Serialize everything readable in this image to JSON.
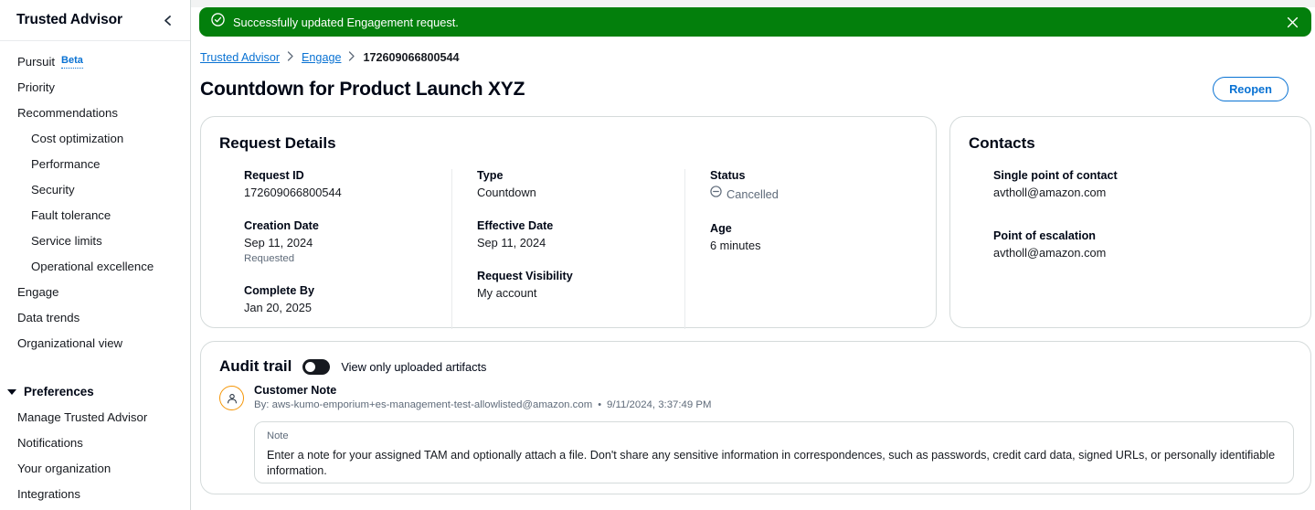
{
  "sidebar": {
    "title": "Trusted Advisor",
    "collapse_icon": "chevron-left-icon",
    "items": [
      {
        "label": "Pursuit",
        "badge": "Beta",
        "sub": false
      },
      {
        "label": "Priority",
        "sub": false
      },
      {
        "label": "Recommendations",
        "sub": false
      },
      {
        "label": "Cost optimization",
        "sub": true
      },
      {
        "label": "Performance",
        "sub": true
      },
      {
        "label": "Security",
        "sub": true
      },
      {
        "label": "Fault tolerance",
        "sub": true
      },
      {
        "label": "Service limits",
        "sub": true
      },
      {
        "label": "Operational excellence",
        "sub": true
      },
      {
        "label": "Engage",
        "sub": false
      },
      {
        "label": "Data trends",
        "sub": false
      },
      {
        "label": "Organizational view",
        "sub": false
      }
    ],
    "preferences": {
      "title": "Preferences",
      "items": [
        {
          "label": "Manage Trusted Advisor"
        },
        {
          "label": "Notifications"
        },
        {
          "label": "Your organization"
        },
        {
          "label": "Integrations"
        }
      ]
    }
  },
  "flash": {
    "icon": "success-check-circle-icon",
    "message": "Successfully updated Engagement request.",
    "close_icon": "close-icon",
    "color": "#037f0c"
  },
  "breadcrumb": {
    "items": [
      {
        "label": "Trusted Advisor",
        "link": true
      },
      {
        "label": "Engage",
        "link": true
      },
      {
        "label": "172609066800544",
        "link": false
      }
    ],
    "separator": "›"
  },
  "page": {
    "title": "Countdown for Product Launch XYZ",
    "reopen_label": "Reopen"
  },
  "request_details": {
    "title": "Request Details",
    "columns": [
      {
        "fields": [
          {
            "label": "Request ID",
            "value": "172609066800544"
          },
          {
            "label": "Creation Date",
            "value": "Sep 11, 2024",
            "sub": "Requested"
          },
          {
            "label": "Complete By",
            "value": "Jan 20, 2025"
          }
        ]
      },
      {
        "fields": [
          {
            "label": "Type",
            "value": "Countdown"
          },
          {
            "label": "Effective Date",
            "value": "Sep 11, 2024"
          },
          {
            "label": "Request Visibility",
            "value": "My account"
          }
        ]
      },
      {
        "fields": [
          {
            "label": "Status",
            "value": "Cancelled",
            "icon": "circle-minus-icon",
            "status": true
          },
          {
            "label": "Age",
            "value": "6 minutes"
          }
        ]
      }
    ]
  },
  "contacts": {
    "title": "Contacts",
    "fields": [
      {
        "label": "Single point of contact",
        "value": "avtholl@amazon.com"
      },
      {
        "label": "Point of escalation",
        "value": "avtholl@amazon.com"
      }
    ]
  },
  "audit_trail": {
    "title": "Audit trail",
    "toggle_label": "View only uploaded artifacts",
    "toggle_on": false,
    "entry": {
      "avatar_icon": "user-avatar-icon",
      "title": "Customer Note",
      "author": "By: aws-kumo-emporium+es-management-test-allowlisted@amazon.com",
      "separator": "•",
      "timestamp": "9/11/2024, 3:37:49 PM"
    },
    "note": {
      "label": "Note",
      "text": "Enter a note for your assigned TAM and optionally attach a file. Don't share any sensitive information in correspondences, such as passwords, credit card data, signed URLs, or personally identifiable information."
    }
  }
}
